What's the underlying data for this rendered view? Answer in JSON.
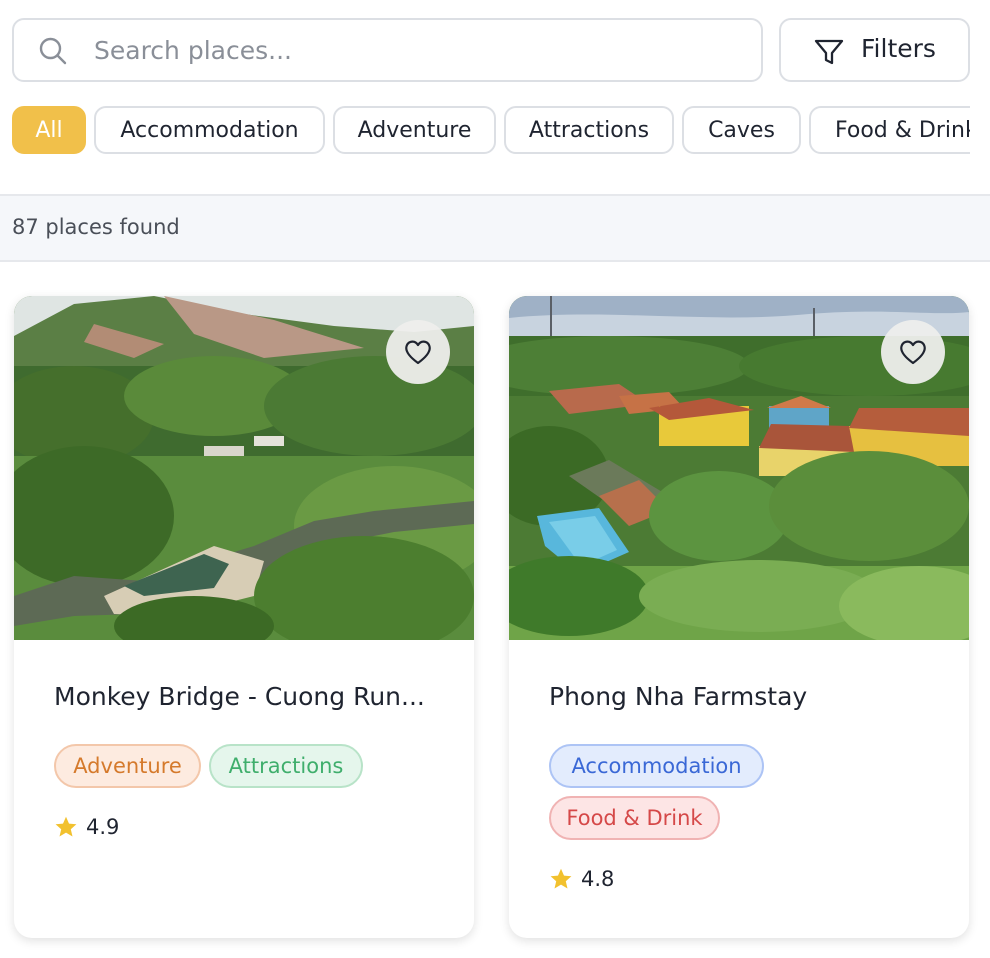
{
  "search": {
    "placeholder": "Search places...",
    "value": ""
  },
  "filters_button": {
    "label": "Filters"
  },
  "categories": [
    "All",
    "Accommodation",
    "Adventure",
    "Attractions",
    "Caves",
    "Food & Drink"
  ],
  "active_category": "All",
  "results_count": "87 places found",
  "places": [
    {
      "title": "Monkey Bridge - Cuong Run...",
      "tags": [
        "Adventure",
        "Attractions"
      ],
      "rating": "4.9"
    },
    {
      "title": "Phong Nha Farmstay",
      "tags": [
        "Accommodation",
        "Food & Drink"
      ],
      "rating": "4.8"
    }
  ],
  "colors": {
    "accent": "#f1c04a",
    "star": "#f2c12e",
    "tag_adventure": "#d57a2c",
    "tag_attractions": "#3fae6c",
    "tag_accommodation": "#3a68d6",
    "tag_food": "#d54848"
  }
}
